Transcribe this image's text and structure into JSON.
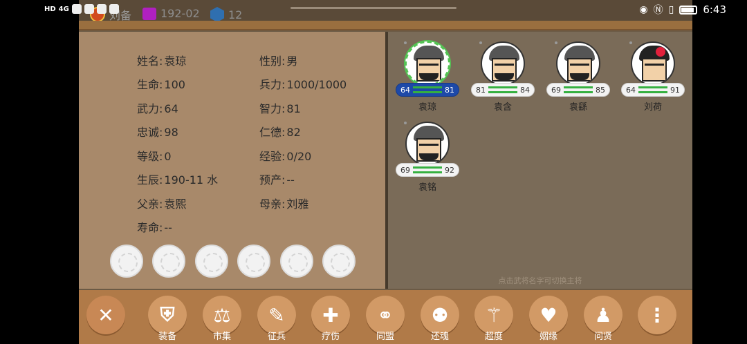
{
  "status_bar": {
    "hd": "HD",
    "network": "4G",
    "time": "6:43",
    "eye_icon": "eye-icon",
    "nfc_icon": "nfc-icon",
    "vibrate_icon": "vibrate-icon",
    "battery_icon": "battery-icon"
  },
  "top": {
    "lord_name": "刘备",
    "date": "192-02",
    "resource": "12"
  },
  "info": {
    "fields": [
      {
        "label": "姓名:",
        "value": "袁琼"
      },
      {
        "label": "性别:",
        "value": "男"
      },
      {
        "label": "生命:",
        "value": "100"
      },
      {
        "label": "兵力:",
        "value": "1000/1000"
      },
      {
        "label": "武力:",
        "value": "64"
      },
      {
        "label": "智力:",
        "value": "81"
      },
      {
        "label": "忠诚:",
        "value": "98"
      },
      {
        "label": "仁德:",
        "value": "82"
      },
      {
        "label": "等级:",
        "value": "0"
      },
      {
        "label": "经验:",
        "value": "0/20"
      },
      {
        "label": "生辰:",
        "value": "190-11 水"
      },
      {
        "label": "预产:",
        "value": "--"
      },
      {
        "label": "父亲:",
        "value": "袁熙"
      },
      {
        "label": "母亲:",
        "value": "刘雅"
      },
      {
        "label": "寿命:",
        "value": "--"
      }
    ]
  },
  "generals": {
    "hint": "点击武将名字可切换主将",
    "list": [
      {
        "name": "袁琼",
        "str": "64",
        "int": "81",
        "selected": true,
        "female": false
      },
      {
        "name": "袁含",
        "str": "81",
        "int": "84",
        "selected": false,
        "female": false
      },
      {
        "name": "袁繇",
        "str": "69",
        "int": "85",
        "selected": false,
        "female": false
      },
      {
        "name": "刘荷",
        "str": "64",
        "int": "91",
        "selected": false,
        "female": true
      },
      {
        "name": "袁铭",
        "str": "69",
        "int": "92",
        "selected": false,
        "female": false
      }
    ]
  },
  "toolbar": {
    "close_icon": "close-icon",
    "items": [
      {
        "label": "装备",
        "icon": "armor-icon"
      },
      {
        "label": "市集",
        "icon": "scale-icon"
      },
      {
        "label": "征兵",
        "icon": "recruit-icon"
      },
      {
        "label": "疗伤",
        "icon": "heal-icon"
      },
      {
        "label": "同盟",
        "icon": "handshake-icon"
      },
      {
        "label": "还魂",
        "icon": "revive-icon"
      },
      {
        "label": "超度",
        "icon": "transcend-icon"
      },
      {
        "label": "姻缘",
        "icon": "heart-icon"
      },
      {
        "label": "问贤",
        "icon": "sage-icon"
      }
    ],
    "more_icon": "more-icon"
  },
  "colors": {
    "panel_left": "#a8896a",
    "panel_right": "#7a6b58",
    "toolbar": "#b07a48",
    "selected_badge": "#1d49a8",
    "bar_green": "#35b040"
  }
}
